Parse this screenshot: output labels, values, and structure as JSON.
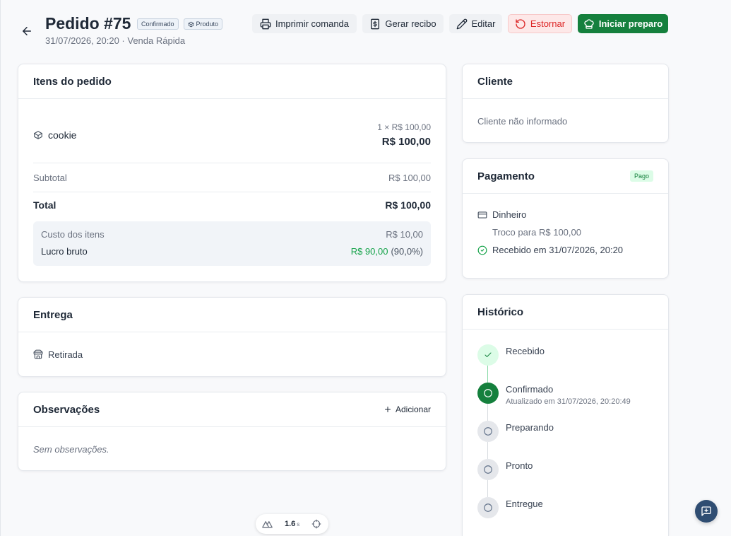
{
  "header": {
    "title": "Pedido #75",
    "status_badge": "Confirmado",
    "type_badge": {
      "label": "Produto",
      "icon": "package-icon"
    },
    "subtitle": "31/07/2026, 20:20 · Venda Rápida",
    "actions": {
      "print": {
        "label": "Imprimir comanda",
        "icon": "printer-icon"
      },
      "receipt": {
        "label": "Gerar recibo",
        "icon": "receipt-icon"
      },
      "edit": {
        "label": "Editar",
        "icon": "pencil-icon"
      },
      "refund": {
        "label": "Estornar",
        "icon": "undo-icon"
      },
      "start": {
        "label": "Iniciar preparo",
        "icon": "chef-hat-icon"
      }
    }
  },
  "order_items": {
    "title": "Itens do pedido",
    "list": [
      {
        "name": "cookie",
        "quantity_price": "1 × R$ 100,00",
        "total": "R$ 100,00",
        "icon": "package-icon"
      }
    ],
    "subtotal": {
      "label": "Subtotal",
      "value": "R$ 100,00"
    },
    "total": {
      "label": "Total",
      "value": "R$ 100,00"
    },
    "cost": {
      "label": "Custo dos itens",
      "value": "R$ 10,00"
    },
    "gross_profit": {
      "label": "Lucro bruto",
      "value": "R$ 90,00",
      "percent": "(90,0%)"
    }
  },
  "delivery": {
    "title": "Entrega",
    "method": "Retirada",
    "icon": "store-icon"
  },
  "notes": {
    "title": "Observações",
    "add_label": "Adicionar",
    "empty_text": "Sem observações."
  },
  "customer": {
    "title": "Cliente",
    "empty_text": "Cliente não informado"
  },
  "payment": {
    "title": "Pagamento",
    "status": "Pago",
    "method": "Dinheiro",
    "change": "Troco para R$ 100,00",
    "received": "Recebido em 31/07/2026, 20:20"
  },
  "history": {
    "title": "Histórico",
    "steps": [
      {
        "label": "Recebido",
        "completed": true,
        "current": false
      },
      {
        "label": "Confirmado",
        "completed": false,
        "current": true,
        "detail": "Atualizado em 31/07/2026, 20:20:49"
      },
      {
        "label": "Preparando",
        "completed": false,
        "current": false
      },
      {
        "label": "Pronto",
        "completed": false,
        "current": false
      },
      {
        "label": "Entregue",
        "completed": false,
        "current": false
      }
    ]
  },
  "devtools": {
    "render_time": "1.6",
    "render_unit": "s"
  },
  "colors": {
    "primary": "#15803d",
    "success_text": "#16a34a",
    "success_soft": "#dcfce7",
    "danger": "#dc2626",
    "chat_button": "#2f4d72"
  }
}
